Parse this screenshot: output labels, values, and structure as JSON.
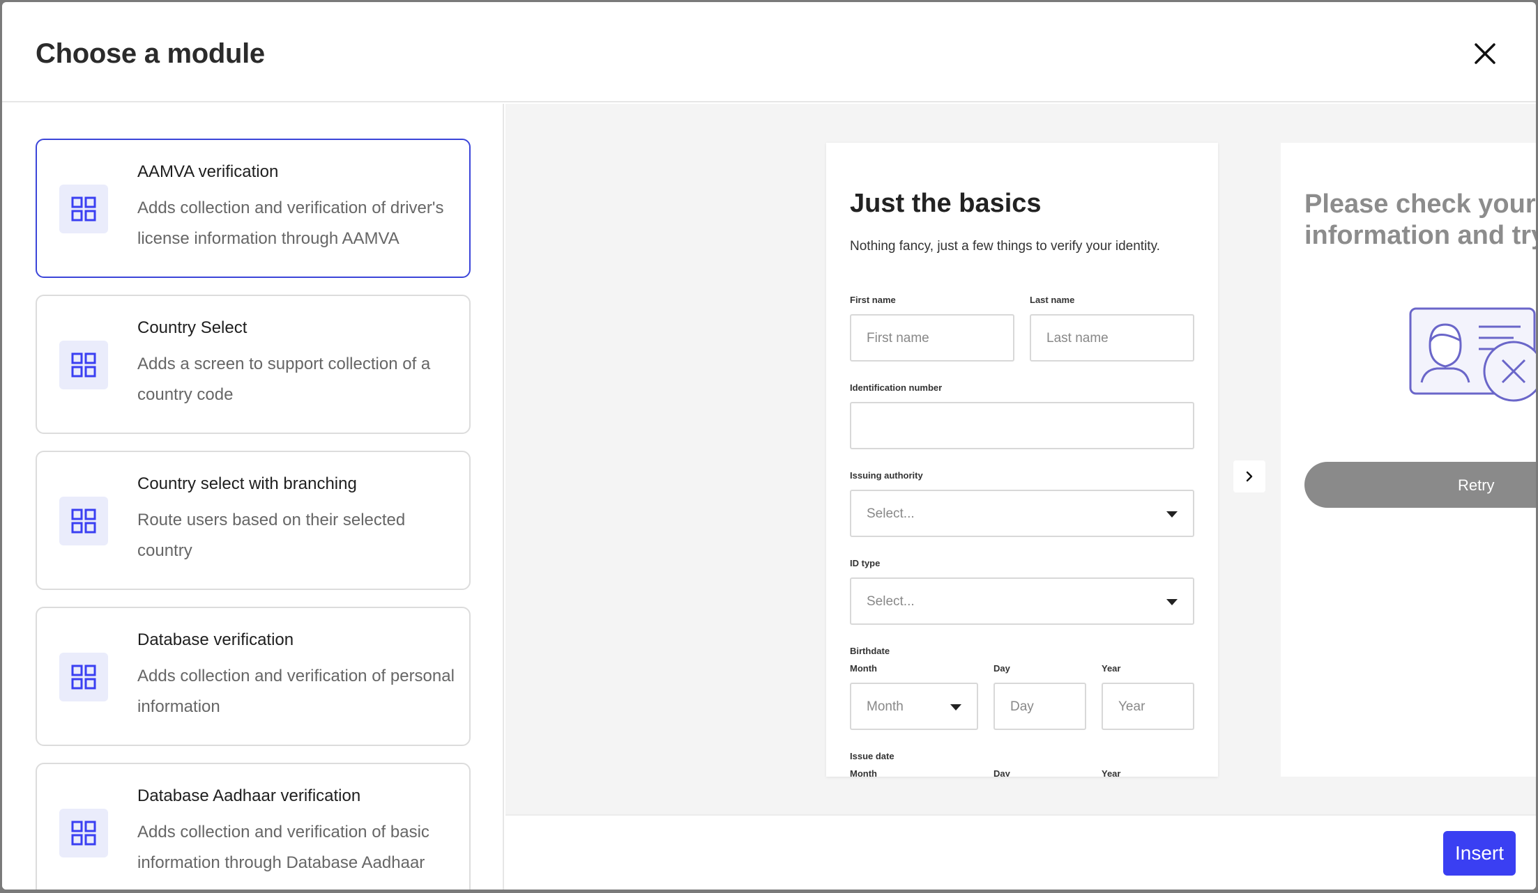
{
  "header": {
    "title": "Choose a module"
  },
  "modules": [
    {
      "title": "AAMVA verification",
      "description": "Adds collection and verification of driver's license information through AAMVA"
    },
    {
      "title": "Country Select",
      "description": "Adds a screen to support collection of a country code"
    },
    {
      "title": "Country select with branching",
      "description": "Route users based on their selected country"
    },
    {
      "title": "Database verification",
      "description": "Adds collection and verification of personal information"
    },
    {
      "title": "Database Aadhaar verification",
      "description": "Adds collection and verification of basic information through Database Aadhaar"
    }
  ],
  "preview": {
    "screen1": {
      "title": "Just the basics",
      "subtitle": "Nothing fancy, just a few things to verify your identity.",
      "first_name_label": "First name",
      "first_name_placeholder": "First name",
      "last_name_label": "Last name",
      "last_name_placeholder": "Last name",
      "id_number_label": "Identification number",
      "issuing_authority_label": "Issuing authority",
      "issuing_authority_value": "Select...",
      "id_type_label": "ID type",
      "id_type_value": "Select...",
      "birthdate_label": "Birthdate",
      "month_label": "Month",
      "day_label": "Day",
      "year_label": "Year",
      "month_value": "Month",
      "day_placeholder": "Day",
      "year_placeholder": "Year",
      "issue_date_label": "Issue date"
    },
    "screen2": {
      "title": "Please check your information and try",
      "retry_label": "Retry"
    }
  },
  "footer": {
    "insert_label": "Insert"
  },
  "colors": {
    "accent": "#3a3ff2",
    "selected_border": "#3b45d9",
    "icon_bg": "#eaecfb"
  },
  "icons": {
    "module": "grid-icon",
    "close": "close-icon",
    "next": "chevron-right-icon",
    "illustration": "id-card-error-icon"
  }
}
